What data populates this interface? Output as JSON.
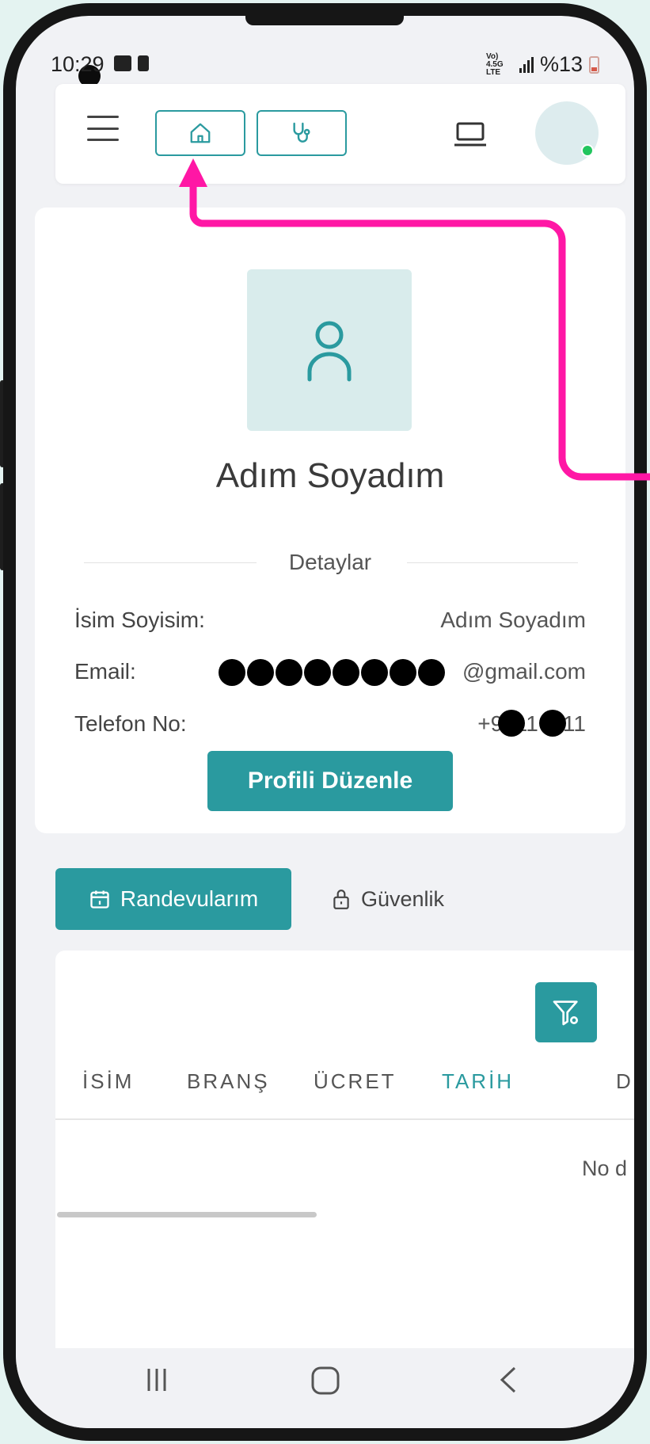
{
  "status_bar": {
    "time": "10:29",
    "network": "Vo) 4.5G LTE",
    "battery": "%13"
  },
  "top_nav": {
    "menu_icon": "hamburger-icon",
    "home_icon": "home-icon",
    "doctor_icon": "stethoscope-icon",
    "laptop_icon": "laptop-icon",
    "avatar_status": "online"
  },
  "profile": {
    "name": "Adım Soyadım",
    "details_title": "Detaylar",
    "rows": [
      {
        "label": "İsim Soyisim:",
        "value": "Adım Soyadım"
      },
      {
        "label": "Email:",
        "value": "@gmail.com"
      },
      {
        "label": "Telefon No:",
        "value": "+9011  1  11"
      }
    ],
    "edit_button": "Profili Düzenle"
  },
  "tabs": {
    "appointments": "Randevularım",
    "security": "Güvenlik"
  },
  "table": {
    "columns": [
      "İSİM",
      "BRANŞ",
      "ÜCRET",
      "TARİH",
      "D"
    ],
    "active_column": "TARİH",
    "empty_text": "No d"
  },
  "colors": {
    "accent": "#2a9a9f",
    "annotation_arrow": "#ff17a5"
  }
}
